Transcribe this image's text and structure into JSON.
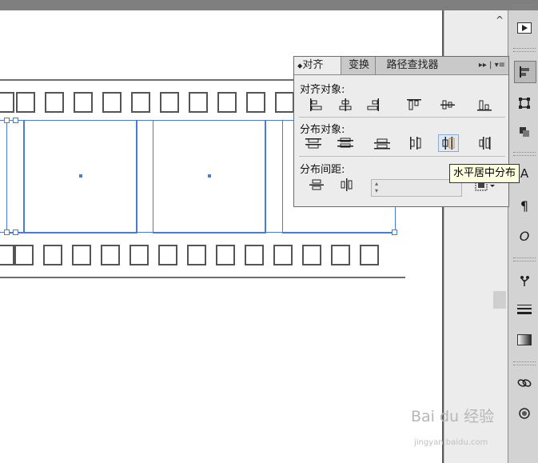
{
  "panel": {
    "tabs": [
      {
        "label": "对齐"
      },
      {
        "label": "变换"
      },
      {
        "label": "路径查找器"
      }
    ],
    "menu_glyph": "▸▸ | ▾≡",
    "align_objects_label": "对齐对象:",
    "distribute_objects_label": "分布对象:",
    "distribute_spacing_label": "分布间距:"
  },
  "tooltip": {
    "text": "水平居中分布"
  },
  "watermark": {
    "brand": "Bai du 经验",
    "url": "jingyan.baidu.com"
  },
  "colors": {
    "selection": "#4a7bd8",
    "dock_bg": "#d3d3d3",
    "panel_bg": "#ececec",
    "tooltip_bg": "#ffffe1"
  },
  "icons": {
    "dock": [
      "play-icon",
      "align-icon",
      "transform-icon",
      "pathfinder-icon",
      "paragraph-icon",
      "opentype-icon",
      "symbols-icon",
      "stroke-icon",
      "gradient-icon",
      "links-icon",
      "appearance-icon"
    ]
  }
}
